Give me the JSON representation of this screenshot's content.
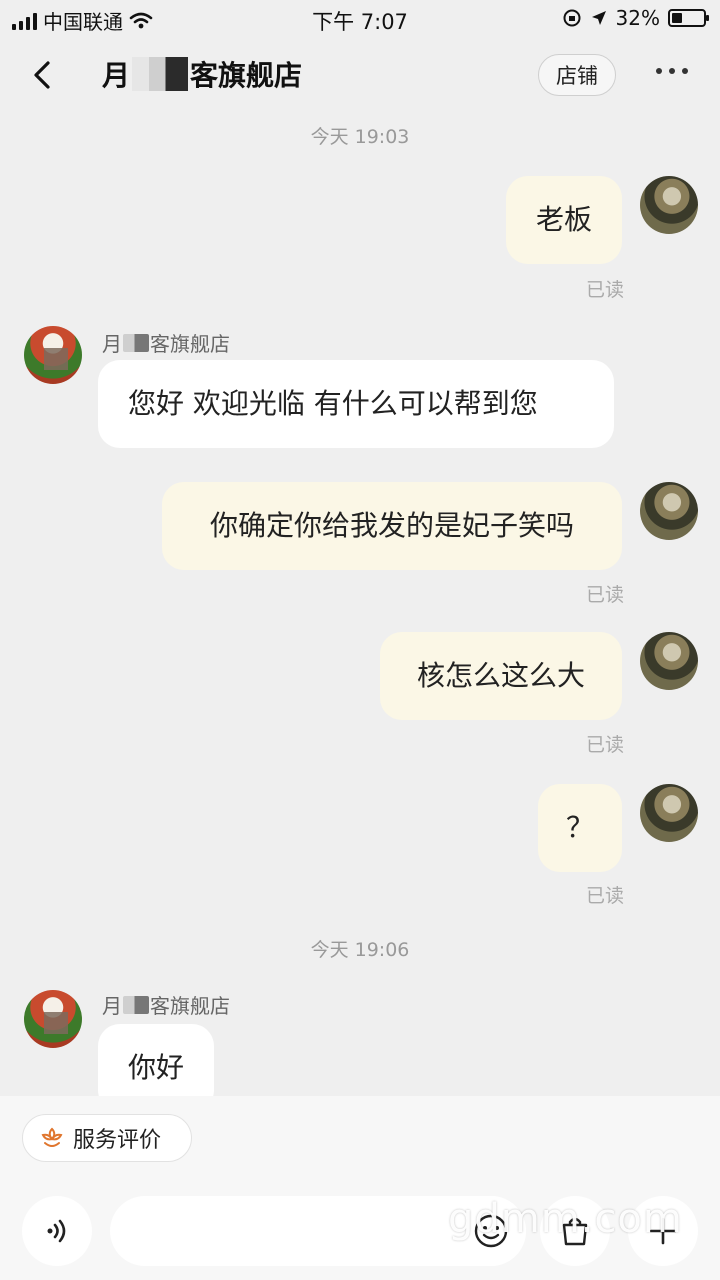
{
  "status_bar": {
    "carrier": "中国联通",
    "time": "下午 7:07",
    "battery_percent": "32%"
  },
  "header": {
    "title_prefix": "月",
    "title_suffix": "客旗舰店",
    "shop_button_label": "店铺",
    "more_icon": "more-horizontal-icon",
    "back_icon": "chevron-left-icon"
  },
  "chat": {
    "timestamps": [
      "今天 19:03",
      "今天 19:06"
    ],
    "shop_name_prefix": "月",
    "shop_name_suffix": "客旗舰店",
    "read_label": "已读",
    "messages": [
      {
        "side": "right",
        "text": "老板",
        "read": true
      },
      {
        "side": "left",
        "text": "您好  欢迎光临 有什么可以帮到您"
      },
      {
        "side": "right",
        "text": "你确定你给我发的是妃子笑吗",
        "read": true
      },
      {
        "side": "right",
        "text": "核怎么这么大",
        "read": true
      },
      {
        "side": "right",
        "text": "？",
        "read": true
      },
      {
        "side": "left",
        "text": "你好"
      }
    ]
  },
  "toolbar": {
    "service_rating_label": "服务评价",
    "service_icon": "flower-icon"
  },
  "input": {
    "voice_icon": "voice-icon",
    "emoji_icon": "emoji-icon",
    "goods_icon": "shopping-bag-icon",
    "plus_icon": "plus-icon"
  },
  "watermark": "gdmm.com",
  "colors": {
    "background": "#efefef",
    "bubble_self": "#fbf7e6",
    "bubble_other": "#ffffff",
    "muted_text": "#999999"
  }
}
